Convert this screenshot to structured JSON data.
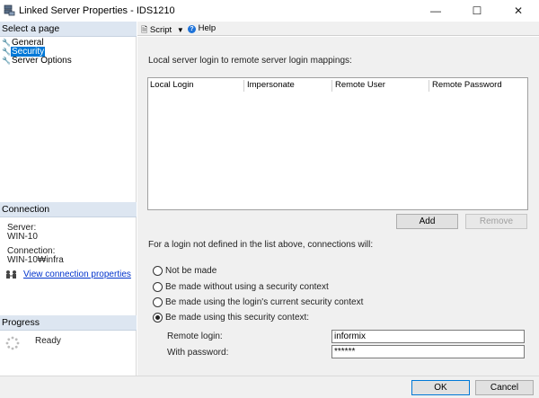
{
  "window": {
    "title": "Linked Server Properties - IDS1210",
    "minimize_glyph": "—",
    "maximize_glyph": "☐",
    "close_glyph": "✕"
  },
  "left": {
    "select_page_header": "Select a page",
    "pages": [
      {
        "label": "General",
        "icon": "wrench-icon",
        "selected": false
      },
      {
        "label": "Security",
        "icon": "wrench-icon",
        "selected": true
      },
      {
        "label": "Server Options",
        "icon": "wrench-icon",
        "selected": false
      }
    ],
    "connection_header": "Connection",
    "server_label": "Server:",
    "server_value": "WIN-10",
    "connection_label": "Connection:",
    "connection_value": "WIN-10₩infra",
    "view_connection_link": "View connection properties",
    "progress_header": "Progress",
    "progress_status": "Ready"
  },
  "toolbar": {
    "script_label": "Script",
    "help_label": "Help"
  },
  "main": {
    "mappings_label": "Local server login to remote server login mappings:",
    "grid_columns": [
      "Local Login",
      "Impersonate",
      "Remote User",
      "Remote Password"
    ],
    "add_button": "Add",
    "remove_button": "Remove",
    "not_defined_label": "For a login not defined in the list above, connections will:",
    "options": [
      {
        "label": "Not be made",
        "checked": false
      },
      {
        "label": "Be made without using a security context",
        "checked": false
      },
      {
        "label": "Be made using the login's current security context",
        "checked": false
      },
      {
        "label": "Be made using this security context:",
        "checked": true
      }
    ],
    "remote_login_label": "Remote login:",
    "remote_login_value": "informix",
    "with_password_label": "With password:",
    "with_password_value": "******"
  },
  "footer": {
    "ok_button": "OK",
    "cancel_button": "Cancel"
  },
  "colors": {
    "selection": "#0078d7",
    "section_header": "#dde6f1",
    "pane_bg": "#f0f0f0",
    "link": "#0033cc"
  }
}
